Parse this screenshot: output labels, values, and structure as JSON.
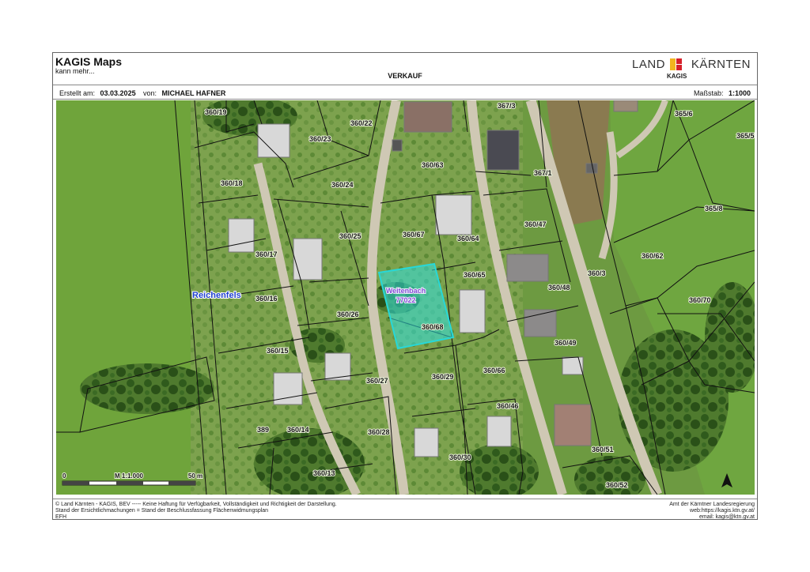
{
  "header": {
    "brand_title": "KAGIS Maps",
    "brand_subtitle": "kann mehr...",
    "document_title": "VERKAUF",
    "logo_left": "LAND",
    "logo_right": "KÄRNTEN",
    "logo_sub": "KAGIS"
  },
  "meta": {
    "created_label": "Erstellt am:",
    "created_value": "03.03.2025",
    "author_label": "von:",
    "author_value": "MICHAEL HAFNER",
    "scale_label": "Maßstab:",
    "scale_value": "1:1000"
  },
  "map": {
    "place_label": "Reichenfels",
    "highlight_name": "Weitenbach",
    "highlight_number": "77022",
    "parcels": [
      "360/19",
      "360/22",
      "360/23",
      "360/18",
      "360/24",
      "360/63",
      "367/3",
      "367/1",
      "365/6",
      "365/5",
      "365/8",
      "360/67",
      "360/64",
      "360/47",
      "360/17",
      "360/25",
      "360/65",
      "360/62",
      "360/3",
      "360/16",
      "360/48",
      "360/70",
      "360/26",
      "360/68",
      "360/49",
      "360/15",
      "360/66",
      "360/27",
      "360/29",
      "360/46",
      "389",
      "360/14",
      "360/28",
      "360/51",
      "360/30",
      "360/13",
      "360/52"
    ],
    "scalebar": {
      "start": "0",
      "middle": "M 1:1.000",
      "end": "50 m"
    },
    "north_icon": "north-arrow-icon",
    "highlight_color": "#2fe0e0"
  },
  "footer": {
    "left_lines": [
      "© Land Kärnten - KAGIS, BEV ----- Keine Haftung für Verfügbarkeit, Vollständigkeit und Richtigkeit der Darstellung.",
      "Stand der Ersichtlichmachungen = Stand der Beschlussfassung Flächenwidmungsplan",
      "EFH"
    ],
    "right_lines": [
      "Amt der Kärntner Landesregierung",
      "web:https://kagis.ktn.gv.at/",
      "email: kagis@ktn.gv.at"
    ]
  }
}
